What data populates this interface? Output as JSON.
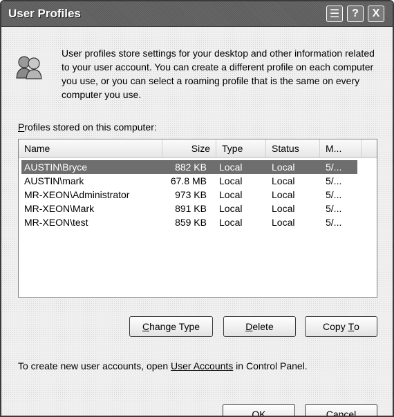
{
  "window": {
    "title": "User Profiles",
    "context_button": "☰",
    "help_button": "?",
    "close_button": "X"
  },
  "intro_text": "User profiles store settings for your desktop and other information related to your user account. You can create a different profile on each computer you use, or you can select a roaming profile that is the same on every computer you use.",
  "list_label_accel": "P",
  "list_label_rest": "rofiles stored on this computer:",
  "columns": [
    "Name",
    "Size",
    "Type",
    "Status",
    "M..."
  ],
  "profiles": [
    {
      "name": "AUSTIN\\Bryce",
      "size": "882 KB",
      "type": "Local",
      "status": "Local",
      "modified": "5/...",
      "selected": true
    },
    {
      "name": "AUSTIN\\mark",
      "size": "67.8 MB",
      "type": "Local",
      "status": "Local",
      "modified": "5/..."
    },
    {
      "name": "MR-XEON\\Administrator",
      "size": "973 KB",
      "type": "Local",
      "status": "Local",
      "modified": "5/..."
    },
    {
      "name": "MR-XEON\\Mark",
      "size": "891 KB",
      "type": "Local",
      "status": "Local",
      "modified": "5/..."
    },
    {
      "name": "MR-XEON\\test",
      "size": "859 KB",
      "type": "Local",
      "status": "Local",
      "modified": "5/..."
    }
  ],
  "buttons": {
    "change_type_accel": "C",
    "change_type_rest": "hange Type",
    "delete_accel": "D",
    "delete_rest": "elete",
    "copy_to_pre": "Copy ",
    "copy_to_accel": "T",
    "copy_to_rest": "o",
    "ok": "OK",
    "cancel": "Cancel"
  },
  "footer": {
    "before": "To create new user accounts, open ",
    "link": "User Accounts",
    "after": " in Control Panel."
  }
}
